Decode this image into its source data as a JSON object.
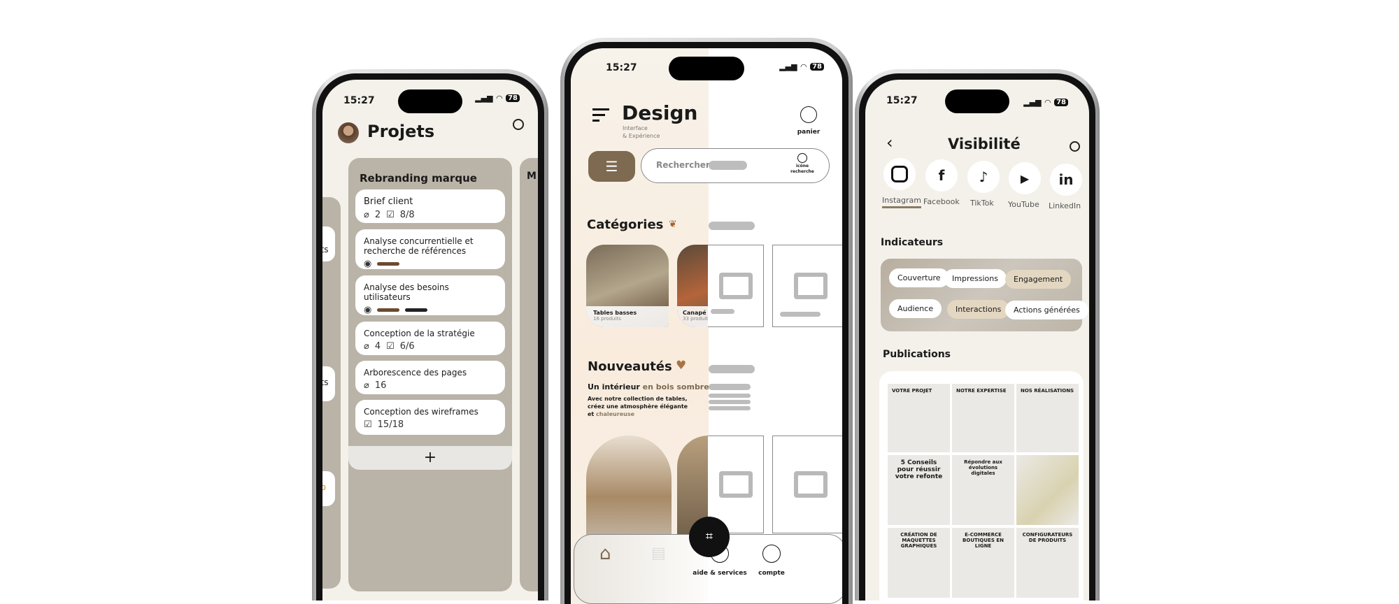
{
  "status": {
    "time": "15:27",
    "battery": "78"
  },
  "projets": {
    "title": "Projets",
    "column_title": "Rebranding marque",
    "left_fragments": [
      "nts",
      "nts",
      "eb"
    ],
    "right_fragment": "M",
    "tasks": [
      {
        "title": "Brief client",
        "attachments": "2",
        "checklist": "8/8"
      },
      {
        "title": "Analyse concurrentielle et recherche de références",
        "labels": [
          "#6b4a2e"
        ]
      },
      {
        "title": "Analyse des besoins utilisateurs",
        "labels": [
          "#6b4a2e",
          "#222222"
        ]
      },
      {
        "title": "Conception de la stratégie",
        "attachments": "4",
        "checklist": "6/6"
      },
      {
        "title": "Arborescence des pages",
        "attachments": "16"
      },
      {
        "title": "Conception des wireframes",
        "checklist": "15/18"
      }
    ],
    "add_label": "+"
  },
  "design": {
    "title": "Design",
    "subtitle1": "Interface",
    "subtitle2": "& Expérience",
    "cart_label": "panier",
    "search_placeholder": "Rechercher",
    "search_icon_label1": "icône",
    "search_icon_label2": "recherche",
    "categories_title": "Catégories",
    "categories": [
      {
        "name": "Tables basses",
        "count": "16 produits"
      },
      {
        "name": "Canapé",
        "count": "33 produits"
      }
    ],
    "news_title": "Nouveautés",
    "news_headline_a": "Un intérieur",
    "news_headline_b": "en bois sombre",
    "news_body": "Avec notre collection de tables, créez une atmosphère élégante et",
    "news_body_accent": "chaleureuse",
    "nav": {
      "help": "aide & services",
      "account": "compte"
    },
    "accent": "#7d6a50"
  },
  "visibilite": {
    "title": "Visibilité",
    "networks": [
      {
        "name": "Instagram",
        "active": true
      },
      {
        "name": "Facebook"
      },
      {
        "name": "TikTok"
      },
      {
        "name": "YouTube"
      },
      {
        "name": "LinkedIn"
      }
    ],
    "indicators_title": "Indicateurs",
    "indicators": [
      {
        "label": "Couverture"
      },
      {
        "label": "Impressions"
      },
      {
        "label": "Engagement",
        "active": true
      },
      {
        "label": "Audience"
      },
      {
        "label": "Interactions",
        "active": true
      },
      {
        "label": "Actions générées"
      }
    ],
    "publications_title": "Publications",
    "posts": [
      "VOTRE PROJET",
      "NOTRE EXPERTISE",
      "NOS RÉALISATIONS",
      "5 Conseils pour réussir votre refonte",
      "Répondre aux évolutions digitales",
      "",
      "CRÉATION DE MAQUETTES GRAPHIQUES",
      "E-COMMERCE BOUTIQUES EN LIGNE",
      "CONFIGURATEURS DE PRODUITS"
    ]
  }
}
